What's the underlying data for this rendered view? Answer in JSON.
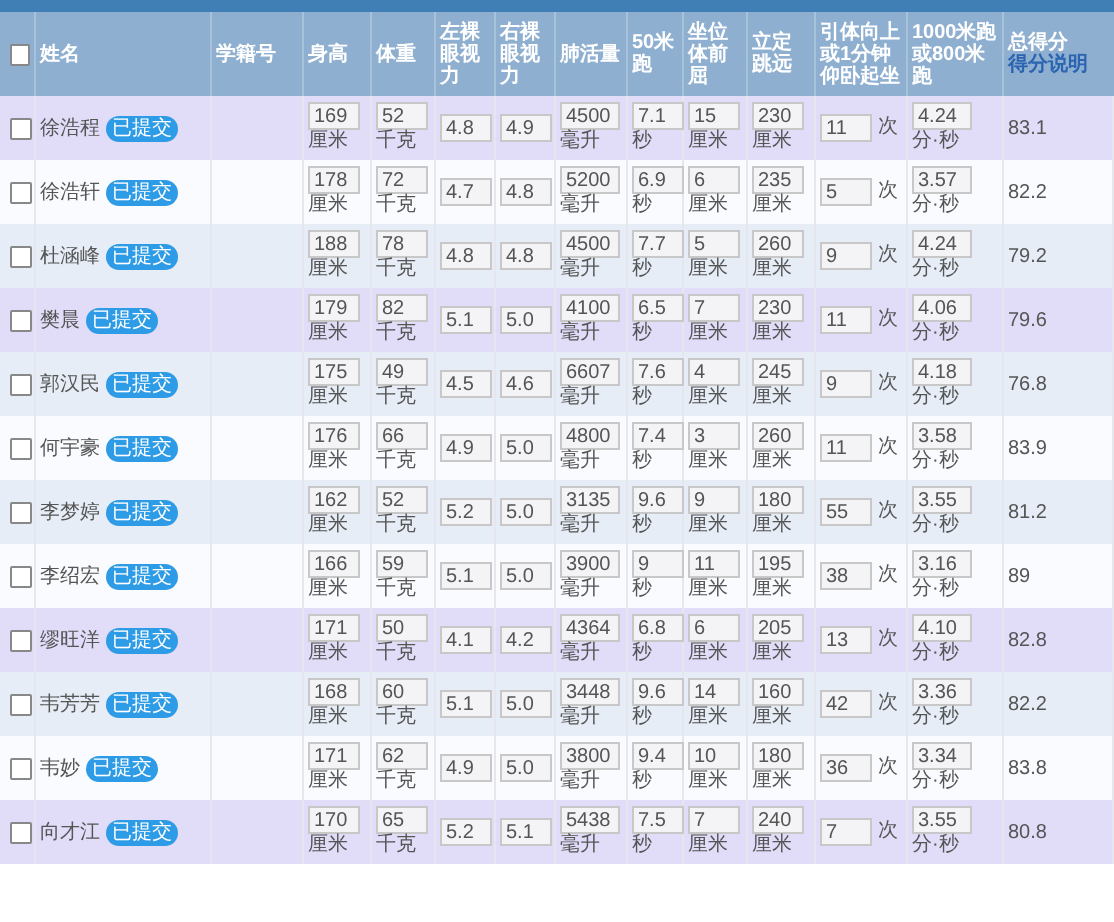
{
  "header": {
    "select_all_checked": false,
    "columns": [
      {
        "label": "姓名"
      },
      {
        "label": "学籍号"
      },
      {
        "label": "身高"
      },
      {
        "label": "体重"
      },
      {
        "label": "左裸眼视力"
      },
      {
        "label": "右裸眼视力"
      },
      {
        "label": "肺活量"
      },
      {
        "label": "50米跑"
      },
      {
        "label": "坐位体前屈"
      },
      {
        "label": "立定跳远"
      },
      {
        "label": "引体向上或1分钟仰卧起坐"
      },
      {
        "label": "1000米跑或800米跑"
      }
    ],
    "score_label": "总得分",
    "score_link": "得分说明"
  },
  "rows": [
    {
      "kind": "purple",
      "checked": false,
      "name": "徐浩程",
      "badge": "已提交",
      "values": [
        {
          "kind": "stacked",
          "v": "169",
          "unit": "厘米"
        },
        {
          "kind": "stacked",
          "v": "52",
          "unit": "千克"
        },
        {
          "kind": "stacked",
          "v": "4.8"
        },
        {
          "kind": "stacked",
          "v": "4.9"
        },
        {
          "kind": "stacked",
          "v": "4500",
          "unit": "毫升"
        },
        {
          "kind": "stacked",
          "v": "7.1",
          "unit": "秒"
        },
        {
          "kind": "stacked",
          "v": "15",
          "unit": "厘米"
        },
        {
          "kind": "stacked",
          "v": "230",
          "unit": "厘米"
        },
        {
          "kind": "inline",
          "v": "11",
          "unit": "次"
        },
        {
          "kind": "stacked",
          "v": "4.24",
          "unit": "分·秒"
        }
      ],
      "score": "83.1"
    },
    {
      "kind": "plain",
      "checked": false,
      "name": "徐浩轩",
      "badge": "已提交",
      "values": [
        {
          "kind": "stacked",
          "v": "178",
          "unit": "厘米"
        },
        {
          "kind": "stacked",
          "v": "72",
          "unit": "千克"
        },
        {
          "kind": "stacked",
          "v": "4.7"
        },
        {
          "kind": "stacked",
          "v": "4.8"
        },
        {
          "kind": "stacked",
          "v": "5200",
          "unit": "毫升"
        },
        {
          "kind": "stacked",
          "v": "6.9",
          "unit": "秒"
        },
        {
          "kind": "stacked",
          "v": "6",
          "unit": "厘米"
        },
        {
          "kind": "stacked",
          "v": "235",
          "unit": "厘米"
        },
        {
          "kind": "inline",
          "v": "5",
          "unit": "次"
        },
        {
          "kind": "stacked",
          "v": "3.57",
          "unit": "分·秒"
        }
      ],
      "score": "82.2"
    },
    {
      "kind": "blue",
      "checked": false,
      "name": "杜涵峰",
      "badge": "已提交",
      "values": [
        {
          "kind": "stacked",
          "v": "188",
          "unit": "厘米"
        },
        {
          "kind": "stacked",
          "v": "78",
          "unit": "千克"
        },
        {
          "kind": "stacked",
          "v": "4.8"
        },
        {
          "kind": "stacked",
          "v": "4.8"
        },
        {
          "kind": "stacked",
          "v": "4500",
          "unit": "毫升"
        },
        {
          "kind": "stacked",
          "v": "7.7",
          "unit": "秒"
        },
        {
          "kind": "stacked",
          "v": "5",
          "unit": "厘米"
        },
        {
          "kind": "stacked",
          "v": "260",
          "unit": "厘米"
        },
        {
          "kind": "inline",
          "v": "9",
          "unit": "次"
        },
        {
          "kind": "stacked",
          "v": "4.24",
          "unit": "分·秒"
        }
      ],
      "score": "79.2"
    },
    {
      "kind": "purple",
      "checked": false,
      "name": "樊晨",
      "badge": "已提交",
      "values": [
        {
          "kind": "stacked",
          "v": "179",
          "unit": "厘米"
        },
        {
          "kind": "stacked",
          "v": "82",
          "unit": "千克"
        },
        {
          "kind": "stacked",
          "v": "5.1"
        },
        {
          "kind": "stacked",
          "v": "5.0"
        },
        {
          "kind": "stacked",
          "v": "4100",
          "unit": "毫升"
        },
        {
          "kind": "stacked",
          "v": "6.5",
          "unit": "秒"
        },
        {
          "kind": "stacked",
          "v": "7",
          "unit": "厘米"
        },
        {
          "kind": "stacked",
          "v": "230",
          "unit": "厘米"
        },
        {
          "kind": "inline",
          "v": "11",
          "unit": "次"
        },
        {
          "kind": "stacked",
          "v": "4.06",
          "unit": "分·秒"
        }
      ],
      "score": "79.6"
    },
    {
      "kind": "blue",
      "checked": false,
      "name": "郭汉民",
      "badge": "已提交",
      "values": [
        {
          "kind": "stacked",
          "v": "175",
          "unit": "厘米"
        },
        {
          "kind": "stacked",
          "v": "49",
          "unit": "千克"
        },
        {
          "kind": "stacked",
          "v": "4.5"
        },
        {
          "kind": "stacked",
          "v": "4.6"
        },
        {
          "kind": "stacked",
          "v": "6607",
          "unit": "毫升"
        },
        {
          "kind": "stacked",
          "v": "7.6",
          "unit": "秒"
        },
        {
          "kind": "stacked",
          "v": "4",
          "unit": "厘米"
        },
        {
          "kind": "stacked",
          "v": "245",
          "unit": "厘米"
        },
        {
          "kind": "inline",
          "v": "9",
          "unit": "次"
        },
        {
          "kind": "stacked",
          "v": "4.18",
          "unit": "分·秒"
        }
      ],
      "score": "76.8"
    },
    {
      "kind": "plain",
      "checked": false,
      "name": "何宇豪",
      "badge": "已提交",
      "values": [
        {
          "kind": "stacked",
          "v": "176",
          "unit": "厘米"
        },
        {
          "kind": "stacked",
          "v": "66",
          "unit": "千克"
        },
        {
          "kind": "stacked",
          "v": "4.9"
        },
        {
          "kind": "stacked",
          "v": "5.0"
        },
        {
          "kind": "stacked",
          "v": "4800",
          "unit": "毫升"
        },
        {
          "kind": "stacked",
          "v": "7.4",
          "unit": "秒"
        },
        {
          "kind": "stacked",
          "v": "3",
          "unit": "厘米"
        },
        {
          "kind": "stacked",
          "v": "260",
          "unit": "厘米"
        },
        {
          "kind": "inline",
          "v": "11",
          "unit": "次"
        },
        {
          "kind": "stacked",
          "v": "3.58",
          "unit": "分·秒"
        }
      ],
      "score": "83.9"
    },
    {
      "kind": "blue",
      "checked": false,
      "name": "李梦婷",
      "badge": "已提交",
      "values": [
        {
          "kind": "stacked",
          "v": "162",
          "unit": "厘米"
        },
        {
          "kind": "stacked",
          "v": "52",
          "unit": "千克"
        },
        {
          "kind": "stacked",
          "v": "5.2"
        },
        {
          "kind": "stacked",
          "v": "5.0"
        },
        {
          "kind": "stacked",
          "v": "3135",
          "unit": "毫升"
        },
        {
          "kind": "stacked",
          "v": "9.6",
          "unit": "秒"
        },
        {
          "kind": "stacked",
          "v": "9",
          "unit": "厘米"
        },
        {
          "kind": "stacked",
          "v": "180",
          "unit": "厘米"
        },
        {
          "kind": "inline",
          "v": "55",
          "unit": "次"
        },
        {
          "kind": "stacked",
          "v": "3.55",
          "unit": "分·秒"
        }
      ],
      "score": "81.2"
    },
    {
      "kind": "plain",
      "checked": false,
      "name": "李绍宏",
      "badge": "已提交",
      "values": [
        {
          "kind": "stacked",
          "v": "166",
          "unit": "厘米"
        },
        {
          "kind": "stacked",
          "v": "59",
          "unit": "千克"
        },
        {
          "kind": "stacked",
          "v": "5.1"
        },
        {
          "kind": "stacked",
          "v": "5.0"
        },
        {
          "kind": "stacked",
          "v": "3900",
          "unit": "毫升"
        },
        {
          "kind": "stacked",
          "v": "9",
          "unit": "秒"
        },
        {
          "kind": "stacked",
          "v": "11",
          "unit": "厘米"
        },
        {
          "kind": "stacked",
          "v": "195",
          "unit": "厘米"
        },
        {
          "kind": "inline",
          "v": "38",
          "unit": "次"
        },
        {
          "kind": "stacked",
          "v": "3.16",
          "unit": "分·秒"
        }
      ],
      "score": "89"
    },
    {
      "kind": "purple",
      "checked": false,
      "name": "缪旺洋",
      "badge": "已提交",
      "values": [
        {
          "kind": "stacked",
          "v": "171",
          "unit": "厘米"
        },
        {
          "kind": "stacked",
          "v": "50",
          "unit": "千克"
        },
        {
          "kind": "stacked",
          "v": "4.1"
        },
        {
          "kind": "stacked",
          "v": "4.2"
        },
        {
          "kind": "stacked",
          "v": "4364",
          "unit": "毫升"
        },
        {
          "kind": "stacked",
          "v": "6.8",
          "unit": "秒"
        },
        {
          "kind": "stacked",
          "v": "6",
          "unit": "厘米"
        },
        {
          "kind": "stacked",
          "v": "205",
          "unit": "厘米"
        },
        {
          "kind": "inline",
          "v": "13",
          "unit": "次"
        },
        {
          "kind": "stacked",
          "v": "4.10",
          "unit": "分·秒"
        }
      ],
      "score": "82.8"
    },
    {
      "kind": "blue",
      "checked": false,
      "name": "韦芳芳",
      "badge": "已提交",
      "values": [
        {
          "kind": "stacked",
          "v": "168",
          "unit": "厘米"
        },
        {
          "kind": "stacked",
          "v": "60",
          "unit": "千克"
        },
        {
          "kind": "stacked",
          "v": "5.1"
        },
        {
          "kind": "stacked",
          "v": "5.0"
        },
        {
          "kind": "stacked",
          "v": "3448",
          "unit": "毫升"
        },
        {
          "kind": "stacked",
          "v": "9.6",
          "unit": "秒"
        },
        {
          "kind": "stacked",
          "v": "14",
          "unit": "厘米"
        },
        {
          "kind": "stacked",
          "v": "160",
          "unit": "厘米"
        },
        {
          "kind": "inline",
          "v": "42",
          "unit": "次"
        },
        {
          "kind": "stacked",
          "v": "3.36",
          "unit": "分·秒"
        }
      ],
      "score": "82.2"
    },
    {
      "kind": "plain",
      "checked": false,
      "name": "韦妙",
      "badge": "已提交",
      "values": [
        {
          "kind": "stacked",
          "v": "171",
          "unit": "厘米"
        },
        {
          "kind": "stacked",
          "v": "62",
          "unit": "千克"
        },
        {
          "kind": "stacked",
          "v": "4.9"
        },
        {
          "kind": "stacked",
          "v": "5.0"
        },
        {
          "kind": "stacked",
          "v": "3800",
          "unit": "毫升"
        },
        {
          "kind": "stacked",
          "v": "9.4",
          "unit": "秒"
        },
        {
          "kind": "stacked",
          "v": "10",
          "unit": "厘米"
        },
        {
          "kind": "stacked",
          "v": "180",
          "unit": "厘米"
        },
        {
          "kind": "inline",
          "v": "36",
          "unit": "次"
        },
        {
          "kind": "stacked",
          "v": "3.34",
          "unit": "分·秒"
        }
      ],
      "score": "83.8"
    },
    {
      "kind": "purple",
      "checked": false,
      "name": "向才江",
      "badge": "已提交",
      "values": [
        {
          "kind": "stacked",
          "v": "170",
          "unit": "厘米"
        },
        {
          "kind": "stacked",
          "v": "65",
          "unit": "千克"
        },
        {
          "kind": "stacked",
          "v": "5.2"
        },
        {
          "kind": "stacked",
          "v": "5.1"
        },
        {
          "kind": "stacked",
          "v": "5438",
          "unit": "毫升"
        },
        {
          "kind": "stacked",
          "v": "7.5",
          "unit": "秒"
        },
        {
          "kind": "stacked",
          "v": "7",
          "unit": "厘米"
        },
        {
          "kind": "stacked",
          "v": "240",
          "unit": "厘米"
        },
        {
          "kind": "inline",
          "v": "7",
          "unit": "次"
        },
        {
          "kind": "stacked",
          "v": "3.55",
          "unit": "分·秒"
        }
      ],
      "score": "80.8"
    }
  ]
}
